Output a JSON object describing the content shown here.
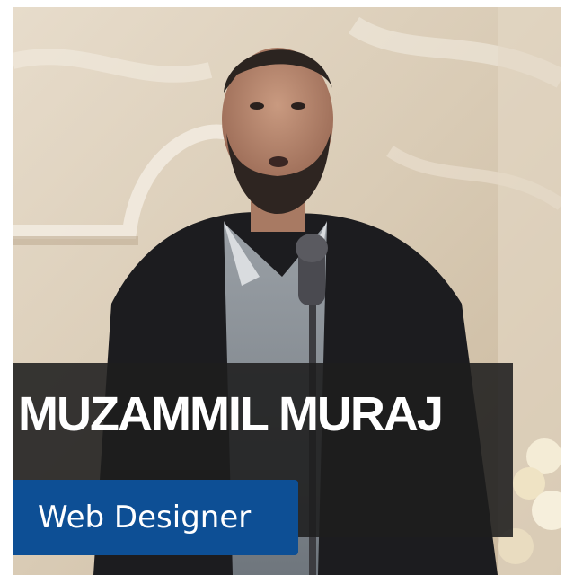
{
  "profile": {
    "name": "MUZAMMIL MURAJ",
    "role": "Web Designer"
  },
  "colors": {
    "banner": "#1e1e1e",
    "badge": "#0d4f95",
    "text": "#ffffff"
  },
  "icons": {
    "photo": "person-speaking-photo"
  }
}
